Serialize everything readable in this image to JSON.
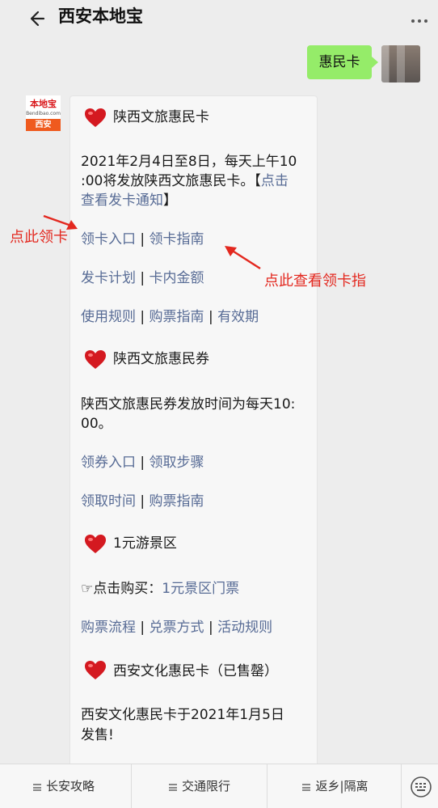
{
  "header": {
    "title": "西安本地宝"
  },
  "my_message": {
    "text": "惠民卡"
  },
  "bot": {
    "logo_text": "本地宝",
    "site_text": "Bendibao.com",
    "city_text": "西安"
  },
  "card": {
    "section1_title": "陕西文旅惠民卡",
    "p1_line1": "2021年2月4日至8日，每天上午10",
    "p1_line2_a": ":00将发放陕西文旅惠民卡。【",
    "p1_line2_link": "点击",
    "p1_line3_link": "查看发卡通知",
    "p1_line3_b": "】",
    "links_row1": [
      "领卡入口",
      "领卡指南"
    ],
    "links_row2": [
      "发卡计划",
      "卡内金额"
    ],
    "links_row3": [
      "使用规则",
      "购票指南",
      "有效期"
    ],
    "section2_title": "陕西文旅惠民券",
    "p2_line1": "陕西文旅惠民券发放时间为每天10:",
    "p2_line2": "00。",
    "links_row4": [
      "领券入口",
      "领取步骤"
    ],
    "links_row5": [
      "领取时间",
      "购票指南"
    ],
    "section3_title": "1元游景区",
    "buy_prefix": "☞点击购买：",
    "buy_link": "1元景区门票",
    "links_row6": [
      "购票流程",
      "兑票方式",
      "活动规则"
    ],
    "section4_title": "西安文化惠民卡（已售罄）",
    "p4_line1": "西安文化惠民卡于2021年1月5日",
    "p4_line2": "发售!",
    "separator": "|"
  },
  "annotations": {
    "left": "点此领卡",
    "right": "点此查看领卡指"
  },
  "bottom_tabs": [
    "长安攻略",
    "交通限行",
    "返乡|隔离"
  ],
  "colors": {
    "link": "#576b95",
    "accent_red": "#e3281f",
    "bubble_green": "#95ec69"
  },
  "icons": [
    "back-arrow-icon",
    "more-dots-icon",
    "heart-icon",
    "menu-lines-icon",
    "keyboard-icon"
  ]
}
